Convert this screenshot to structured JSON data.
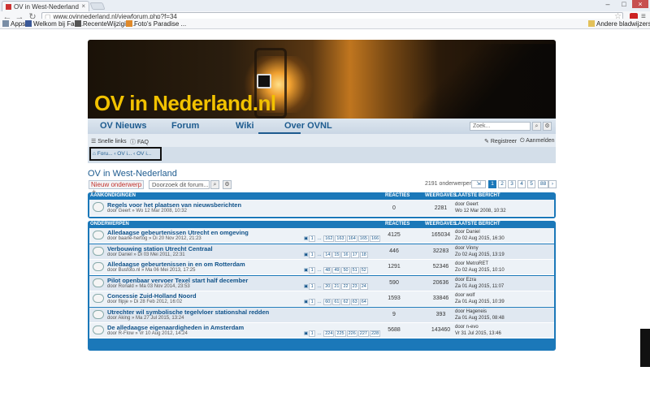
{
  "browser": {
    "tab_title": "OV in West-Nederland",
    "url": "www.ovinnederland.nl/viewforum.php?f=34",
    "bookmarks": [
      "Apps",
      "Welkom bij Fac...",
      "RecenteWijzigin...",
      "Foto's Paradise ..."
    ],
    "other_bookmarks": "Andere bladwijzers"
  },
  "site": {
    "logo": "OV in Nederland.nl",
    "nav": [
      "OV Nieuws",
      "Forum",
      "Wiki",
      "Over OVNL"
    ],
    "search_placeholder": "Zoek...",
    "quicklinks": "Snelle links",
    "faq": "FAQ",
    "register": "Registreer",
    "login": "Aanmelden",
    "breadcrumb": "Foru... ‹ OV i... ‹ OV i..."
  },
  "forum": {
    "title": "OV in West-Nederland",
    "new_topic": "Nieuw onderwerp",
    "search_placeholder": "Doorzoek dit forum...",
    "topic_count": "2191 onderwerpen",
    "pages": [
      "1",
      "2",
      "3",
      "4",
      "5",
      "...",
      "88"
    ],
    "announcements_header": "AANKONDIGINGEN",
    "topics_header": "ONDERWERPEN",
    "col_replies": "REACTIES",
    "col_views": "WEERGAVES",
    "col_last": "LAATSTE BERICHT",
    "announcement": {
      "title": "Regels voor het plaatsen van nieuwsberichten",
      "by": "door Geert » Wo 12 Mar 2008, 10:32",
      "replies": "0",
      "views": "2281",
      "last_by": "door Geert",
      "last_date": "Wo 12 Mar 2008, 10:32"
    },
    "topics": [
      {
        "title": "Alledaagse gebeurtenissen Utrecht en omgeving",
        "by": "door baarle-hertog » Di 20 Nov 2012, 21:23",
        "pages": [
          "1",
          "...",
          "162",
          "163",
          "164",
          "165",
          "166"
        ],
        "replies": "4125",
        "views": "165034",
        "last_by": "door Daniel",
        "last_date": "Zo 02 Aug 2015, 16:30"
      },
      {
        "title": "Verbouwing station Utrecht Centraal",
        "by": "door Daniel » Di 03 Mei 2011, 22:31",
        "pages": [
          "1",
          "...",
          "14",
          "15",
          "16",
          "17",
          "18"
        ],
        "replies": "446",
        "views": "32283",
        "last_by": "door Vinny",
        "last_date": "Zo 02 Aug 2015, 13:19"
      },
      {
        "title": "Alledaagse gebeurtenissen in en om Rotterdam",
        "by": "door Busfoto.nl » Ma 06 Mei 2013, 17:25",
        "pages": [
          "1",
          "...",
          "48",
          "49",
          "50",
          "51",
          "52"
        ],
        "replies": "1291",
        "views": "52346",
        "last_by": "door MetroRET",
        "last_date": "Zo 02 Aug 2015, 10:10"
      },
      {
        "title": "Pilot openbaar vervoer Texel start half december",
        "by": "door Ronald » Ma 03 Nov 2014, 23:53",
        "pages": [
          "1",
          "...",
          "20",
          "21",
          "22",
          "23",
          "24"
        ],
        "replies": "590",
        "views": "20636",
        "last_by": "door Ezra",
        "last_date": "Za 01 Aug 2015, 11:07"
      },
      {
        "title": "Concessie Zuid-Holland Noord",
        "by": "door flipje » Di 28 Feb 2012, 16:02",
        "pages": [
          "1",
          "...",
          "60",
          "61",
          "62",
          "63",
          "64"
        ],
        "replies": "1593",
        "views": "33846",
        "last_by": "door wolf",
        "last_date": "Za 01 Aug 2015, 10:39"
      },
      {
        "title": "Utrechter wil symbolische tegelvloer stationshal redden",
        "by": "door Aking » Ma 27 Jul 2015, 13:24",
        "pages": [],
        "replies": "9",
        "views": "393",
        "last_by": "door Hageneis",
        "last_date": "Za 01 Aug 2015, 08:48"
      },
      {
        "title": "De alledaagse eigenaardigheden in Amsterdam",
        "by": "door R-Flow » Vr 10 Aug 2012, 14:24",
        "pages": [
          "1",
          "...",
          "224",
          "225",
          "226",
          "227",
          "228"
        ],
        "replies": "5688",
        "views": "143460",
        "last_by": "door n-evo",
        "last_date": "Vr 31 Jul 2015, 13:46"
      }
    ]
  }
}
